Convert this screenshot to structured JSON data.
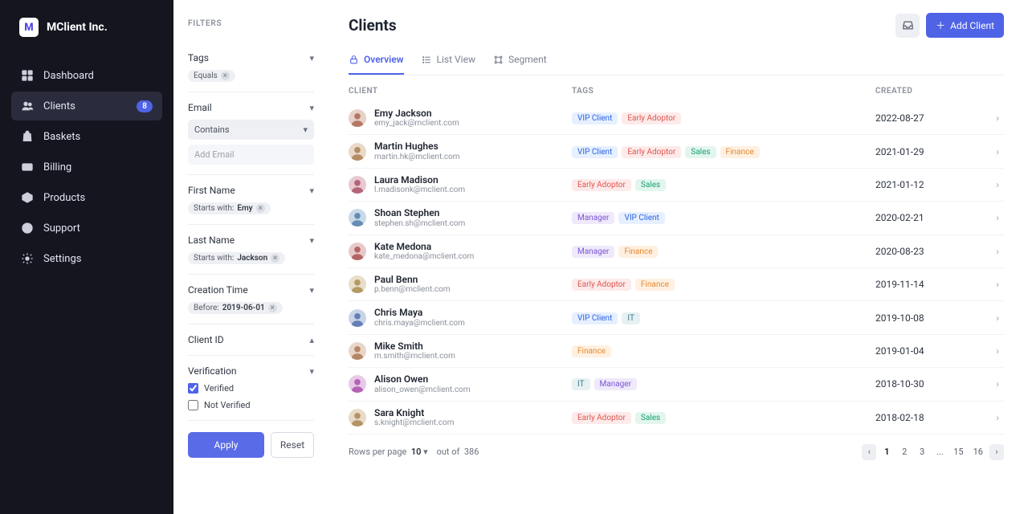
{
  "brand": {
    "name": "MClient Inc.",
    "logo_letter": "M"
  },
  "nav": [
    {
      "id": "dashboard",
      "label": "Dashboard",
      "icon": "grid"
    },
    {
      "id": "clients",
      "label": "Clients",
      "icon": "users",
      "badge": "8",
      "active": true
    },
    {
      "id": "baskets",
      "label": "Baskets",
      "icon": "bag"
    },
    {
      "id": "billing",
      "label": "Billing",
      "icon": "card"
    },
    {
      "id": "products",
      "label": "Products",
      "icon": "box"
    },
    {
      "id": "support",
      "label": "Support",
      "icon": "globe"
    },
    {
      "id": "settings",
      "label": "Settings",
      "icon": "gear"
    }
  ],
  "filters": {
    "title": "FILTERS",
    "tags_label": "Tags",
    "tags_chip": "Equals",
    "email_label": "Email",
    "email_select": "Contains",
    "email_placeholder": "Add Email",
    "firstname_label": "First Name",
    "firstname_prefix": "Starts with:",
    "firstname_value": "Emy",
    "lastname_label": "Last Name",
    "lastname_prefix": "Starts with:",
    "lastname_value": "Jackson",
    "creation_label": "Creation Time",
    "creation_prefix": "Before:",
    "creation_value": "2019-06-01",
    "clientid_label": "Client ID",
    "verification_label": "Verification",
    "verified_label": "Verified",
    "not_verified_label": "Not Verified",
    "apply": "Apply",
    "reset": "Reset"
  },
  "header": {
    "title": "Clients",
    "add_label": "Add Client"
  },
  "tabs": {
    "overview": "Overview",
    "list": "List View",
    "segment": "Segment"
  },
  "columns": {
    "client": "CLIENT",
    "tags": "TAGS",
    "created": "CREATED"
  },
  "tag_styles": {
    "VIP Client": "tag-vip",
    "Early Adoptor": "tag-early",
    "Sales": "tag-sales",
    "Finance": "tag-finance",
    "Manager": "tag-manager",
    "IT": "tag-it"
  },
  "clients": [
    {
      "name": "Emy Jackson",
      "email": "emy_jack@mclient.com",
      "tags": [
        "VIP Client",
        "Early Adoptor"
      ],
      "created": "2022-08-27",
      "hue": 15
    },
    {
      "name": "Martin Hughes",
      "email": "martin.hk@mclient.com",
      "tags": [
        "VIP Client",
        "Early Adoptor",
        "Sales",
        "Finance"
      ],
      "created": "2021-01-29",
      "hue": 30
    },
    {
      "name": "Laura Madison",
      "email": "l.madisonk@mclient.com",
      "tags": [
        "Early Adoptor",
        "Sales"
      ],
      "created": "2021-01-12",
      "hue": 345
    },
    {
      "name": "Shoan Stephen",
      "email": "stephen.sh@mclient.com",
      "tags": [
        "Manager",
        "VIP Client"
      ],
      "created": "2020-02-21",
      "hue": 210
    },
    {
      "name": "Kate Medona",
      "email": "kate_medona@mclient.com",
      "tags": [
        "Manager",
        "Finance"
      ],
      "created": "2020-08-23",
      "hue": 0
    },
    {
      "name": "Paul Benn",
      "email": "p.benn@mclient.com",
      "tags": [
        "Early Adoptor",
        "Finance"
      ],
      "created": "2019-11-14",
      "hue": 40
    },
    {
      "name": "Chris Maya",
      "email": "chris.maya@mclient.com",
      "tags": [
        "VIP Client",
        "IT"
      ],
      "created": "2019-10-08",
      "hue": 220
    },
    {
      "name": "Mike Smith",
      "email": "m.smith@mclient.com",
      "tags": [
        "Finance"
      ],
      "created": "2019-01-04",
      "hue": 25
    },
    {
      "name": "Alison Owen",
      "email": "alison_owen@mclient.com",
      "tags": [
        "IT",
        "Manager"
      ],
      "created": "2018-10-30",
      "hue": 300
    },
    {
      "name": "Sara Knight",
      "email": "s.knight@mclient.com",
      "tags": [
        "Early Adoptor",
        "Sales"
      ],
      "created": "2018-02-18",
      "hue": 35
    }
  ],
  "pager": {
    "rows_label": "Rows per page",
    "rows_value": "10",
    "out_of_label": "out of",
    "total": "386",
    "pages": [
      "1",
      "2",
      "3",
      "...",
      "15",
      "16"
    ],
    "current": "1"
  }
}
